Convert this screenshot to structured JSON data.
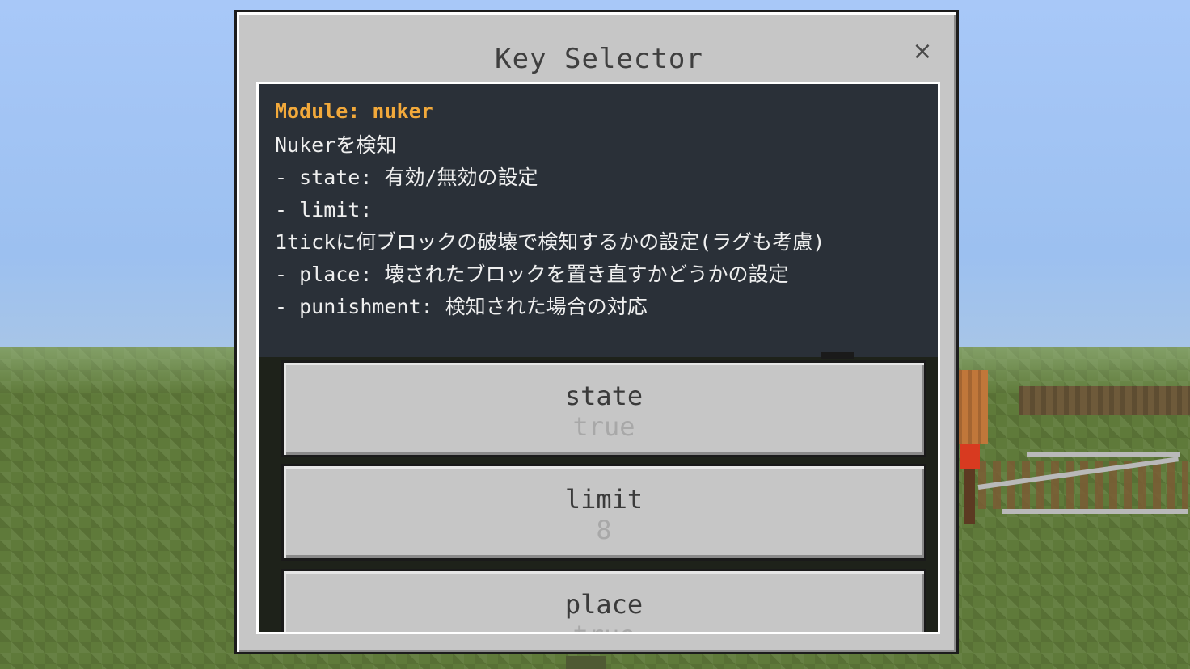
{
  "dialog": {
    "title": "Key Selector",
    "close_label": "×"
  },
  "description": {
    "title": "Module: nuker",
    "lines": [
      "Nukerを検知",
      "- state: 有効/無効の設定",
      "- limit:",
      "1tickに何ブロックの破壊で検知するかの設定(ラグも考慮)",
      "- place: 壊されたブロックを置き直すかどうかの設定",
      "- punishment: 検知された場合の対応"
    ]
  },
  "options": [
    {
      "name": "state",
      "value": "true"
    },
    {
      "name": "limit",
      "value": "8"
    },
    {
      "name": "place",
      "value": "true"
    }
  ],
  "colors": {
    "module_title": "#f2a93b",
    "panel": "#c6c6c6",
    "description_bg": "#2a3038"
  }
}
